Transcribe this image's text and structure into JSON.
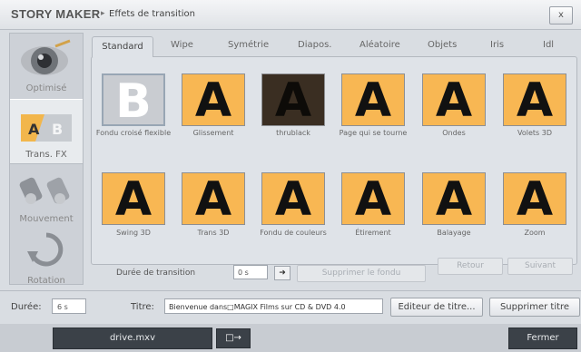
{
  "header": {
    "app_title": "STORY MAKER",
    "separator": "▸",
    "dialog_title": "Effets de transition",
    "close_label": "x"
  },
  "sidebar": {
    "items": [
      {
        "label": "Optimisé",
        "icon": "eye-icon"
      },
      {
        "label": "Trans. FX",
        "icon": "transition-ab-icon"
      },
      {
        "label": "Mouvement",
        "icon": "binoculars-icon"
      },
      {
        "label": "Rotation",
        "icon": "rotate-icon"
      }
    ]
  },
  "tabs": [
    "Standard",
    "Wipe",
    "Symétrie",
    "Diapos.",
    "Aléatoire",
    "Objets",
    "Iris",
    "Idl"
  ],
  "effects": [
    {
      "glyph": "B",
      "label": "Fondu croisé flexible",
      "style": "selected"
    },
    {
      "glyph": "A",
      "label": "Glissement",
      "style": "normal"
    },
    {
      "glyph": "A",
      "label": "thrublack",
      "style": "dark"
    },
    {
      "glyph": "A",
      "label": "Page qui se tourne",
      "style": "normal"
    },
    {
      "glyph": "A",
      "label": "Ondes",
      "style": "normal"
    },
    {
      "glyph": "A",
      "label": "Volets 3D",
      "style": "normal"
    },
    {
      "glyph": "A",
      "label": "Swing 3D",
      "style": "normal"
    },
    {
      "glyph": "A",
      "label": "Trans 3D",
      "style": "normal"
    },
    {
      "glyph": "A",
      "label": "Fondu de couleurs",
      "style": "normal"
    },
    {
      "glyph": "A",
      "label": "Étirement",
      "style": "normal"
    },
    {
      "glyph": "A",
      "label": "Balayage",
      "style": "normal"
    },
    {
      "glyph": "A",
      "label": "Zoom",
      "style": "normal"
    }
  ],
  "transition": {
    "duration_label": "Durée de transition",
    "duration_value": "0 s",
    "apply_arrow": "➜",
    "remove_label": "Supprimer le fondu",
    "prev_label": "Retour",
    "next_label": "Suivant"
  },
  "bottom": {
    "duration_label": "Durée:",
    "duration_value": "6 s",
    "title_label": "Titre:",
    "title_value": "Bienvenue dans□MAGIX Films sur CD & DVD 4.0",
    "edit_title_label": "Editeur de titre...",
    "remove_title_label": "Supprimer titre"
  },
  "footer": {
    "file_name": "drive.mxv",
    "export_symbol": "□→",
    "close_label": "Fermer"
  }
}
